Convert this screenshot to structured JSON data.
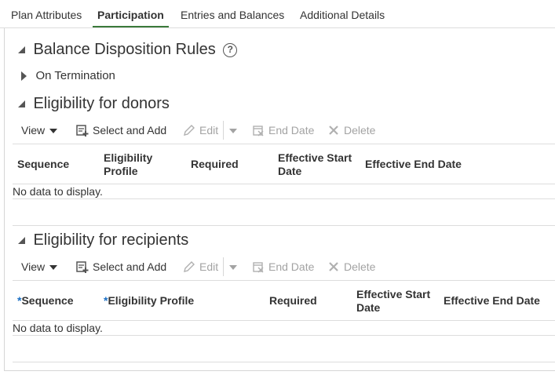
{
  "tabs": [
    {
      "label": "Plan Attributes",
      "active": false
    },
    {
      "label": "Participation",
      "active": true
    },
    {
      "label": "Entries and Balances",
      "active": false
    },
    {
      "label": "Additional Details",
      "active": false
    }
  ],
  "balance_section": {
    "title": "Balance Disposition Rules",
    "help_icon": "question-circle-icon",
    "subsection": "On Termination"
  },
  "donors": {
    "title": "Eligibility for donors",
    "toolbar": {
      "view": "View",
      "select_and_add": "Select and Add",
      "edit": "Edit",
      "end_date": "End Date",
      "delete": "Delete"
    },
    "columns": [
      {
        "label": "Sequence",
        "required": false
      },
      {
        "label": "Eligibility Profile",
        "required": false
      },
      {
        "label": "Required",
        "required": false
      },
      {
        "label": "Effective Start Date",
        "required": false
      },
      {
        "label": "Effective End Date",
        "required": false
      }
    ],
    "empty_text": "No data to display."
  },
  "recipients": {
    "title": "Eligibility for recipients",
    "toolbar": {
      "view": "View",
      "select_and_add": "Select and Add",
      "edit": "Edit",
      "end_date": "End Date",
      "delete": "Delete"
    },
    "columns": [
      {
        "label": "Sequence",
        "required": true
      },
      {
        "label": "Eligibility Profile",
        "required": true
      },
      {
        "label": "Required",
        "required": false
      },
      {
        "label": "Effective Start Date",
        "required": false
      },
      {
        "label": "Effective End Date",
        "required": false
      }
    ],
    "required_marker": "*",
    "empty_text": "No data to display."
  },
  "colors": {
    "active_tab_underline": "#3a7a3a",
    "required_marker": "#1a6fc4",
    "disabled_text": "#a3a3a3"
  }
}
